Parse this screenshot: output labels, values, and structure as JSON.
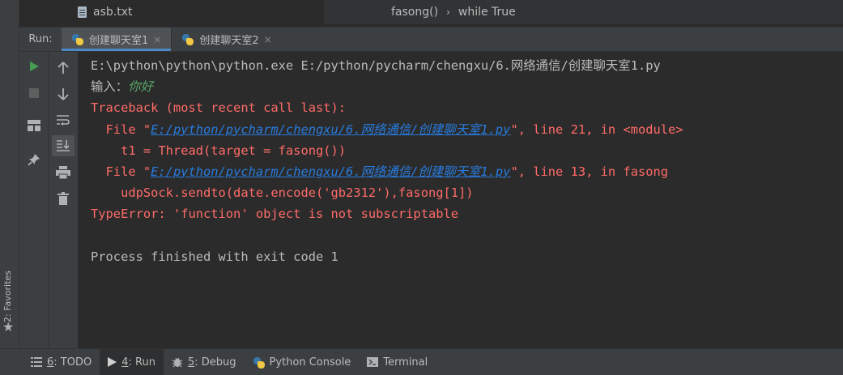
{
  "favorites": {
    "label": "2: Favorites",
    "star_icon": "star-icon"
  },
  "editor": {
    "file_tab": "asb.txt",
    "breadcrumb": [
      "fasong()",
      "while True"
    ]
  },
  "run_panel": {
    "label": "Run:",
    "tabs": [
      {
        "label": "创建聊天室1",
        "active": true
      },
      {
        "label": "创建聊天室2",
        "active": false
      }
    ],
    "close_glyph": "×"
  },
  "toolbar": {
    "col1": [
      "run-icon",
      "stop-icon",
      "layout-icon",
      "pin-icon"
    ],
    "col2": [
      "up-arrow-icon",
      "down-arrow-icon",
      "soft-wrap-icon",
      "scroll-to-end-icon",
      "print-icon",
      "trash-icon"
    ]
  },
  "console": {
    "line1": "E:\\python\\python\\python.exe E:/python/pycharm/chengxu/6.网络通信/创建聊天室1.py",
    "prompt": "输入：",
    "input_value": "你好",
    "traceback_header": "Traceback (most recent call last):",
    "frame1_prefix": "  File \"",
    "frame1_path": "E:/python/pycharm/chengxu/6.网络通信/创建聊天室1.py",
    "frame1_suffix": "\", line 21, in <module>",
    "frame1_code": "    t1 = Thread(target = fasong())",
    "frame2_prefix": "  File \"",
    "frame2_path": "E:/python/pycharm/chengxu/6.网络通信/创建聊天室1.py",
    "frame2_suffix": "\", line 13, in fasong",
    "frame2_code": "    udpSock.sendto(date.encode('gb2312'),fasong[1])",
    "error": "TypeError: 'function' object is not subscriptable",
    "finish": "Process finished with exit code 1"
  },
  "bottom_bar": {
    "items": [
      {
        "key": "6",
        "label": ": TODO",
        "icon": "list-icon"
      },
      {
        "key": "4",
        "label": ": Run",
        "icon": "play-icon",
        "active": true
      },
      {
        "key": "5",
        "label": ": Debug",
        "icon": "bug-icon"
      },
      {
        "key": "",
        "label": "Python Console",
        "icon": "python-icon"
      },
      {
        "key": "",
        "label": "Terminal",
        "icon": "terminal-icon"
      }
    ]
  }
}
